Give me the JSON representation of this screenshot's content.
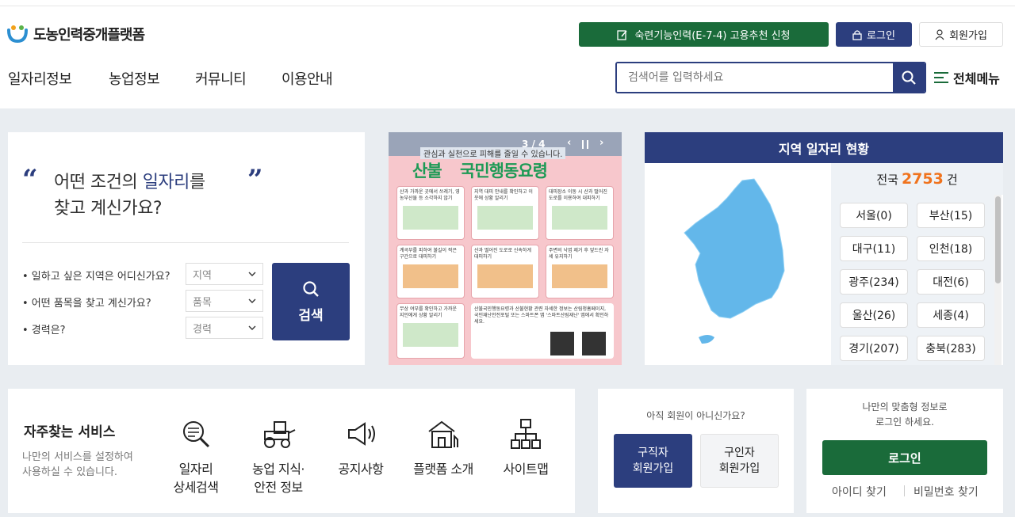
{
  "header": {
    "logo_text": "도농인력중개플랫폼",
    "apply_button": "숙련기능인력(E-7-4) 고용추천 신청",
    "login_button": "로그인",
    "join_button": "회원가입",
    "nav": [
      "일자리정보",
      "농업정보",
      "커뮤니티",
      "이용안내"
    ],
    "search_placeholder": "검색어를 입력하세요",
    "all_menu": "전체메뉴"
  },
  "job_search": {
    "quote_open": "“",
    "quote_close": "”",
    "line1_pre": "어떤 조건의 ",
    "line1_em": "일자리",
    "line1_post": "를",
    "line2": "찾고 계신가요?",
    "questions": [
      {
        "label": "• 일하고 싶은 지역은 어디신가요?",
        "select": "지역"
      },
      {
        "label": "• 어떤 품목을 찾고 계신가요?",
        "select": "품목"
      },
      {
        "label": "• 경력은?",
        "select": "경력"
      }
    ],
    "search_button": "검색"
  },
  "banner": {
    "counter": "3 / 4",
    "top_text": "관심과 실천으로 피해를 줄일 수 있습니다.",
    "title_a": "산불",
    "title_b": "국민행동요령",
    "cells": [
      "산과 가까운 곳에서 쓰레기, 영농부산물 등 소각하지 않기",
      "지역 대피 안내를 확인하고 이웃에 상황 알리기",
      "대피장소 이동 시 산과 떨어진 도로를 이용하여 대피하기",
      "계곡부를 피하여 불길이 적은 구간으로 대피하기",
      "산과 떨어진 도로로 신속하게 대피하기",
      "주변의 낙엽 제거 후 엎드린 자세 유지하기",
      "무상 여부를 확인하고 가까운 지인에게 상황 알리기"
    ],
    "footer_text": "산불국민행동요령과 산불현황 관련 자세한 정보는 산림청홈페이지, 국민재난안전포털 또는 스마트폰 앱 '스마트산림재난' 앱에서 확인하세요."
  },
  "region": {
    "title": "지역 일자리 현황",
    "national_label": "전국",
    "national_count": "2753",
    "national_unit": "건",
    "regions": [
      "서울(0)",
      "부산(15)",
      "대구(11)",
      "인천(18)",
      "광주(234)",
      "대전(6)",
      "울산(26)",
      "세종(4)",
      "경기(207)",
      "충북(283)"
    ]
  },
  "services": {
    "title": "자주찾는 서비스",
    "subtitle_1": "나만의 서비스를 설정하여",
    "subtitle_2": "사용하실 수 있습니다.",
    "items": [
      {
        "l1": "일자리",
        "l2": "상세검색"
      },
      {
        "l1": "농업 지식·",
        "l2": "안전 정보"
      },
      {
        "l1": "공지사항",
        "l2": ""
      },
      {
        "l1": "플랫폼 소개",
        "l2": ""
      },
      {
        "l1": "사이트맵",
        "l2": ""
      }
    ]
  },
  "membership": {
    "question": "아직 회원이 아니신가요?",
    "seeker_l1": "구직자",
    "seeker_l2": "회원가입",
    "employer_l1": "구인자",
    "employer_l2": "회원가입"
  },
  "login_box": {
    "msg1": "나만의 맞춤형 정보로",
    "msg2": "로그인 하세요.",
    "login_button": "로그인",
    "find_id": "아이디 찾기",
    "find_pw": "비밀번호 찾기"
  }
}
